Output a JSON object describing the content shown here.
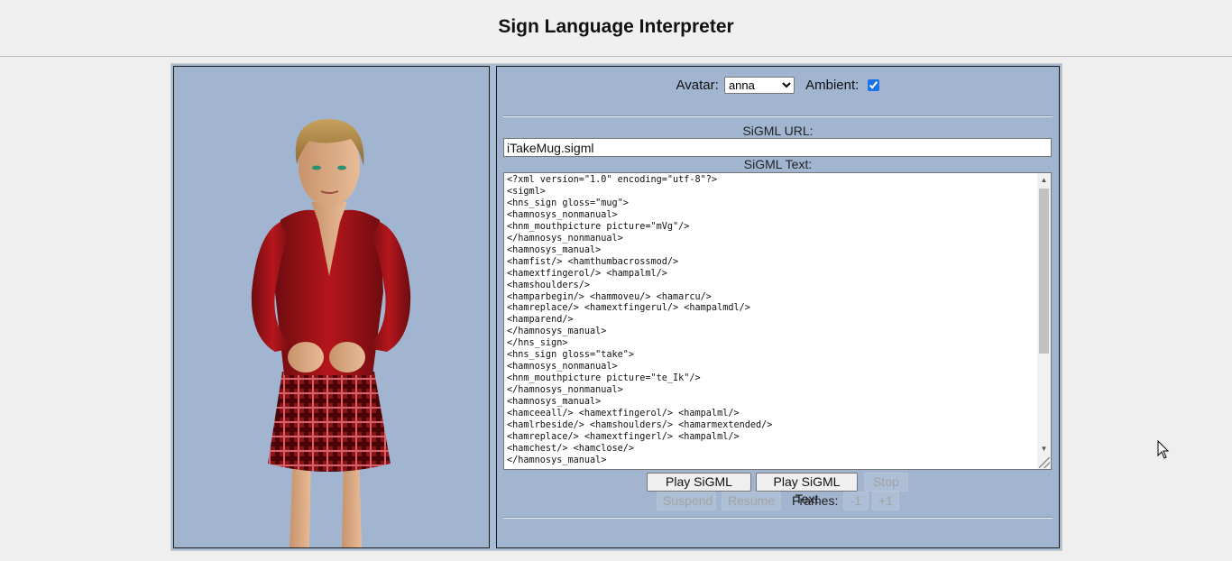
{
  "page": {
    "title": "Sign Language Interpreter"
  },
  "controls": {
    "avatar_label": "Avatar:",
    "avatar_value": "anna",
    "ambient_label": "Ambient:",
    "ambient_checked": true,
    "sigml_url_label": "SiGML URL:",
    "sigml_url_value": "iTakeMug.sigml",
    "sigml_text_label": "SiGML Text:",
    "sigml_text_lines": [
      "<?xml version=\"1.0\" encoding=\"utf-8\"?>",
      "<sigml>",
      "<hns_sign gloss=\"mug\">",
      "<hamnosys_nonmanual>",
      "<hnm_mouthpicture picture=\"mVg\"/>",
      "</hamnosys_nonmanual>",
      "<hamnosys_manual>",
      "<hamfist/> <hamthumbacrossmod/>",
      "<hamextfingerol/> <hampalml/>",
      "<hamshoulders/>",
      "<hamparbegin/> <hammoveu/> <hamarcu/>",
      "<hamreplace/> <hamextfingerul/> <hampalmdl/>",
      "<hamparend/>",
      "</hamnosys_manual>",
      "</hns_sign>",
      "<hns_sign gloss=\"take\">",
      "<hamnosys_nonmanual>",
      "<hnm_mouthpicture picture=\"te_Ik\"/>",
      "</hamnosys_nonmanual>",
      "<hamnosys_manual>",
      "<hamceeall/> <hamextfingerol/> <hampalml/>",
      "<hamlrbeside/> <hamshoulders/> <hamarmextended/>",
      "<hamreplace/> <hamextfingerl/> <hampalml/>",
      "<hamchest/> <hamclose/>",
      "</hamnosys_manual>"
    ]
  },
  "buttons": {
    "play_url": "Play SiGML URL",
    "play_text": "Play SiGML Text",
    "stop": "Stop",
    "suspend": "Suspend",
    "resume": "Resume",
    "frames_label": "Frames:",
    "frame_minus": "-1",
    "frame_plus": "+1"
  },
  "colors": {
    "panel_bg": "#a1b5d1",
    "panel_border": "#1b1b1b",
    "page_bg": "#efefef"
  },
  "icons": {
    "cursor": "mouse-pointer-icon",
    "scroll_up": "scroll-up-arrow-icon",
    "scroll_down": "scroll-down-arrow-icon"
  }
}
